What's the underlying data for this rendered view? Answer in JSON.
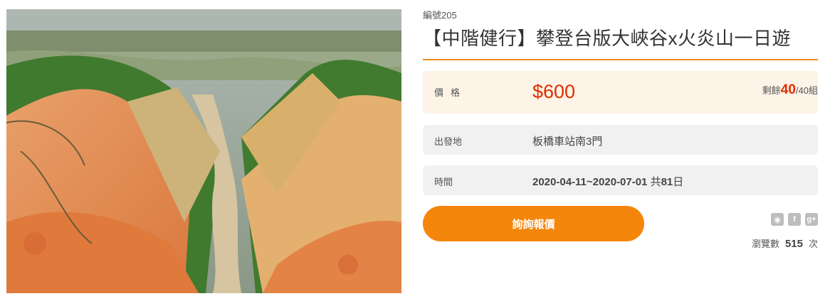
{
  "product": {
    "code": "編號205",
    "title": "【中階健行】攀登台版大峽谷x火炎山一日遊"
  },
  "price": {
    "label": "價格",
    "value": "$600",
    "remaining_prefix": "剩餘",
    "remaining_count": "40",
    "remaining_suffix": "/40組"
  },
  "departure": {
    "label": "出發地",
    "value": "板橋車站南3門"
  },
  "time": {
    "label": "時間",
    "range": "2020-04-11~2020-07-01",
    "total_prefix": "共",
    "days": "81",
    "total_suffix": "日"
  },
  "cta": {
    "label": "詢詢報價"
  },
  "share": {
    "icons": [
      "line-icon",
      "facebook-icon",
      "google-plus-icon"
    ],
    "line_glyph": "◉",
    "facebook_glyph": "f",
    "google_glyph": "g+"
  },
  "views": {
    "label": "瀏覽數",
    "count": "515",
    "unit": "次"
  },
  "colors": {
    "accent": "#f5860c",
    "price_red": "#e02d00",
    "price_row_bg": "#fdf3e6",
    "row_bg": "#f1f1f1"
  }
}
